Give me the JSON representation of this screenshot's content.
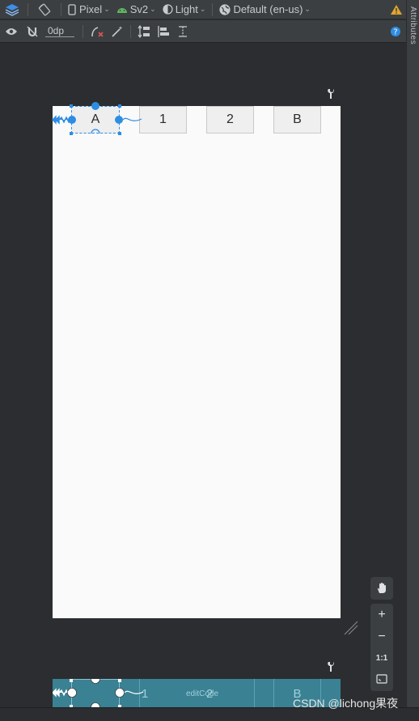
{
  "toolbar": {
    "device": "Pixel",
    "api": "Sv2",
    "theme": "Light",
    "locale": "Default (en-us)",
    "margin": "0dp"
  },
  "side_panel": {
    "label": "Attributes"
  },
  "layout": {
    "buttons": [
      "A",
      "1",
      "2",
      "B"
    ]
  },
  "blueprint": {
    "labels": [
      "1",
      "editCode",
      "2",
      "B"
    ]
  },
  "zoom": {
    "plus": "+",
    "minus": "−",
    "one_to_one": "1:1"
  },
  "watermark": "CSDN @lichong果夜",
  "colors": {
    "accent": "#2d8de3",
    "phone_bg": "#fafafa",
    "blueprint_bg": "#3a8193",
    "warning": "#e2a52c"
  }
}
